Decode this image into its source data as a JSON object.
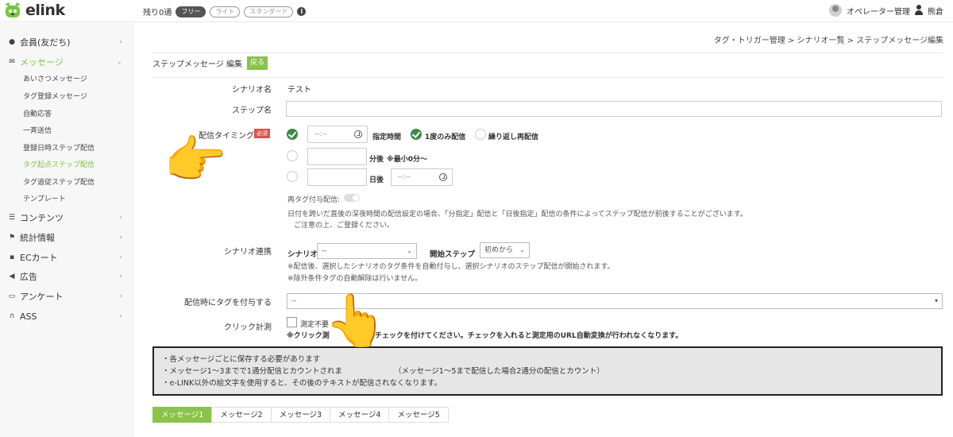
{
  "brand": {
    "logo_text": "elink"
  },
  "plan": {
    "remaining": "残り0通",
    "options": [
      "フリー",
      "ライト",
      "スタンダード"
    ],
    "active_index": 0
  },
  "user": {
    "role": "オペレーター管理",
    "name": "熊倉"
  },
  "sidebar": {
    "items": [
      {
        "label": "会員(友だち)",
        "icon": "user-icon",
        "chev": "‹"
      },
      {
        "label": "メッセージ",
        "icon": "envelope-icon",
        "chev": "›"
      },
      {
        "label": "コンテンツ",
        "icon": "list-icon",
        "chev": "‹"
      },
      {
        "label": "統計情報",
        "icon": "flag-icon",
        "chev": "‹"
      },
      {
        "label": "ECカート",
        "icon": "cart-icon",
        "chev": "‹"
      },
      {
        "label": "広告",
        "icon": "megaphone-icon",
        "chev": "‹"
      },
      {
        "label": "アンケート",
        "icon": "survey-icon",
        "chev": "‹"
      },
      {
        "label": "ASS",
        "icon": "headset-icon",
        "chev": "‹"
      }
    ],
    "sub_items": [
      "あいさつメッセージ",
      "タグ登録メッセージ",
      "自動応答",
      "一斉送信",
      "登録日時ステップ配信",
      "タグ起点ステップ配信",
      "タグ追従ステップ配信",
      "テンプレート"
    ],
    "active_sub": 5
  },
  "breadcrumb": "タグ・トリガー管理 > シナリオ一覧 > ステップメッセージ編集",
  "panel": {
    "title": "ステップメッセージ 編集",
    "back_label": "戻る"
  },
  "form": {
    "scenario_label": "シナリオ名",
    "scenario_value": "テスト",
    "step_label": "ステップ名",
    "timing_label": "配信タイミング",
    "required_badge": "必須",
    "time_placeholder": "--:--",
    "specified_time": "指定時間",
    "once_label": "1度のみ配信",
    "repeat_label": "繰り返し再配信",
    "minutes_after": "分後",
    "minutes_min": "※最小0分〜",
    "days_after": "日後",
    "retag_label": "再タグ付与配信:",
    "retag_note_1": "日付を跨いだ直後の深夜時間の配信設定の場合、「分指定」配信と「日後指定」配信の条件によってステップ配信が前後することがございます。",
    "retag_note_2": "ご注意の上、ご登録ください。",
    "link_label": "シナリオ連携",
    "link_scenario": "シナリオ",
    "link_scenario_value": "--",
    "link_start_label": "開始ステップ",
    "link_start_value": "初めから",
    "link_note_1": "※配信後、選択したシナリオのタグ条件を自動付与し、選択シナリオのステップ配信が開始されます。",
    "link_note_2": "※除外条件タグの自動解除は行いません。",
    "tag_label": "配信時にタグを付与する",
    "tag_value": "--",
    "click_label": "クリック計測",
    "click_checkbox": "測定不要",
    "click_note": "※クリック測",
    "click_note_rest": "合にチェックを付けてください。チェックを入れると測定用のURL自動変換が行われなくなります。"
  },
  "notice": {
    "lines": [
      "・各メッセージごとに保存する必要があります",
      "・メッセージ1〜3までで1通分配信とカウントされま",
      "・e-LINK以外の絵文字を使用すると、その後のテキストが配信されなくなります。"
    ],
    "line2_rest": "（メッセージ1〜5まで配信した場合2通分の配信とカウント）"
  },
  "tabs": [
    "メッセージ1",
    "メッセージ2",
    "メッセージ3",
    "メッセージ4",
    "メッセージ5"
  ],
  "overlays": {
    "pointing_hand": "👉",
    "up_hand": "👆"
  },
  "colors": {
    "accent": "#8bc34a",
    "active_text": "#7cc442",
    "check": "#3b8a4a",
    "required": "#d9534f"
  }
}
